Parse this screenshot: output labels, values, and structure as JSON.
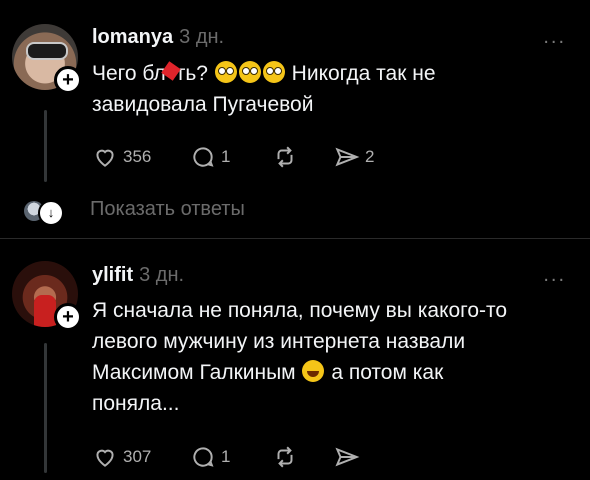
{
  "posts": [
    {
      "username": "lomanya",
      "time": "3 дн.",
      "text_before": "Чего бл",
      "text_after": "ть?",
      "text_tail": "Никогда так не",
      "text_line2": "завидовала Пугачевой",
      "likes": "356",
      "comments": "1",
      "shares": "2"
    },
    {
      "username": "ylifit",
      "time": "3 дн.",
      "text_line1": "Я сначала не поняла, почему вы какого-то",
      "text_line2": "левого мужчину из интернета назвали",
      "text_line3a": "Максимом Галкиным",
      "text_line3b": "а потом как",
      "text_line4": "поняла...",
      "likes": "307",
      "comments": "1"
    }
  ],
  "show_replies_label": "Показать ответы",
  "more_label": "...",
  "icons": {
    "like": "heart-icon",
    "comment": "comment-icon",
    "repost": "repost-icon",
    "share": "send-icon",
    "follow": "plus-icon",
    "more": "more-icon"
  },
  "colors": {
    "background": "#000000",
    "text": "#f3f5f7",
    "muted": "#6b6b6b",
    "censor": "#e0242b"
  }
}
